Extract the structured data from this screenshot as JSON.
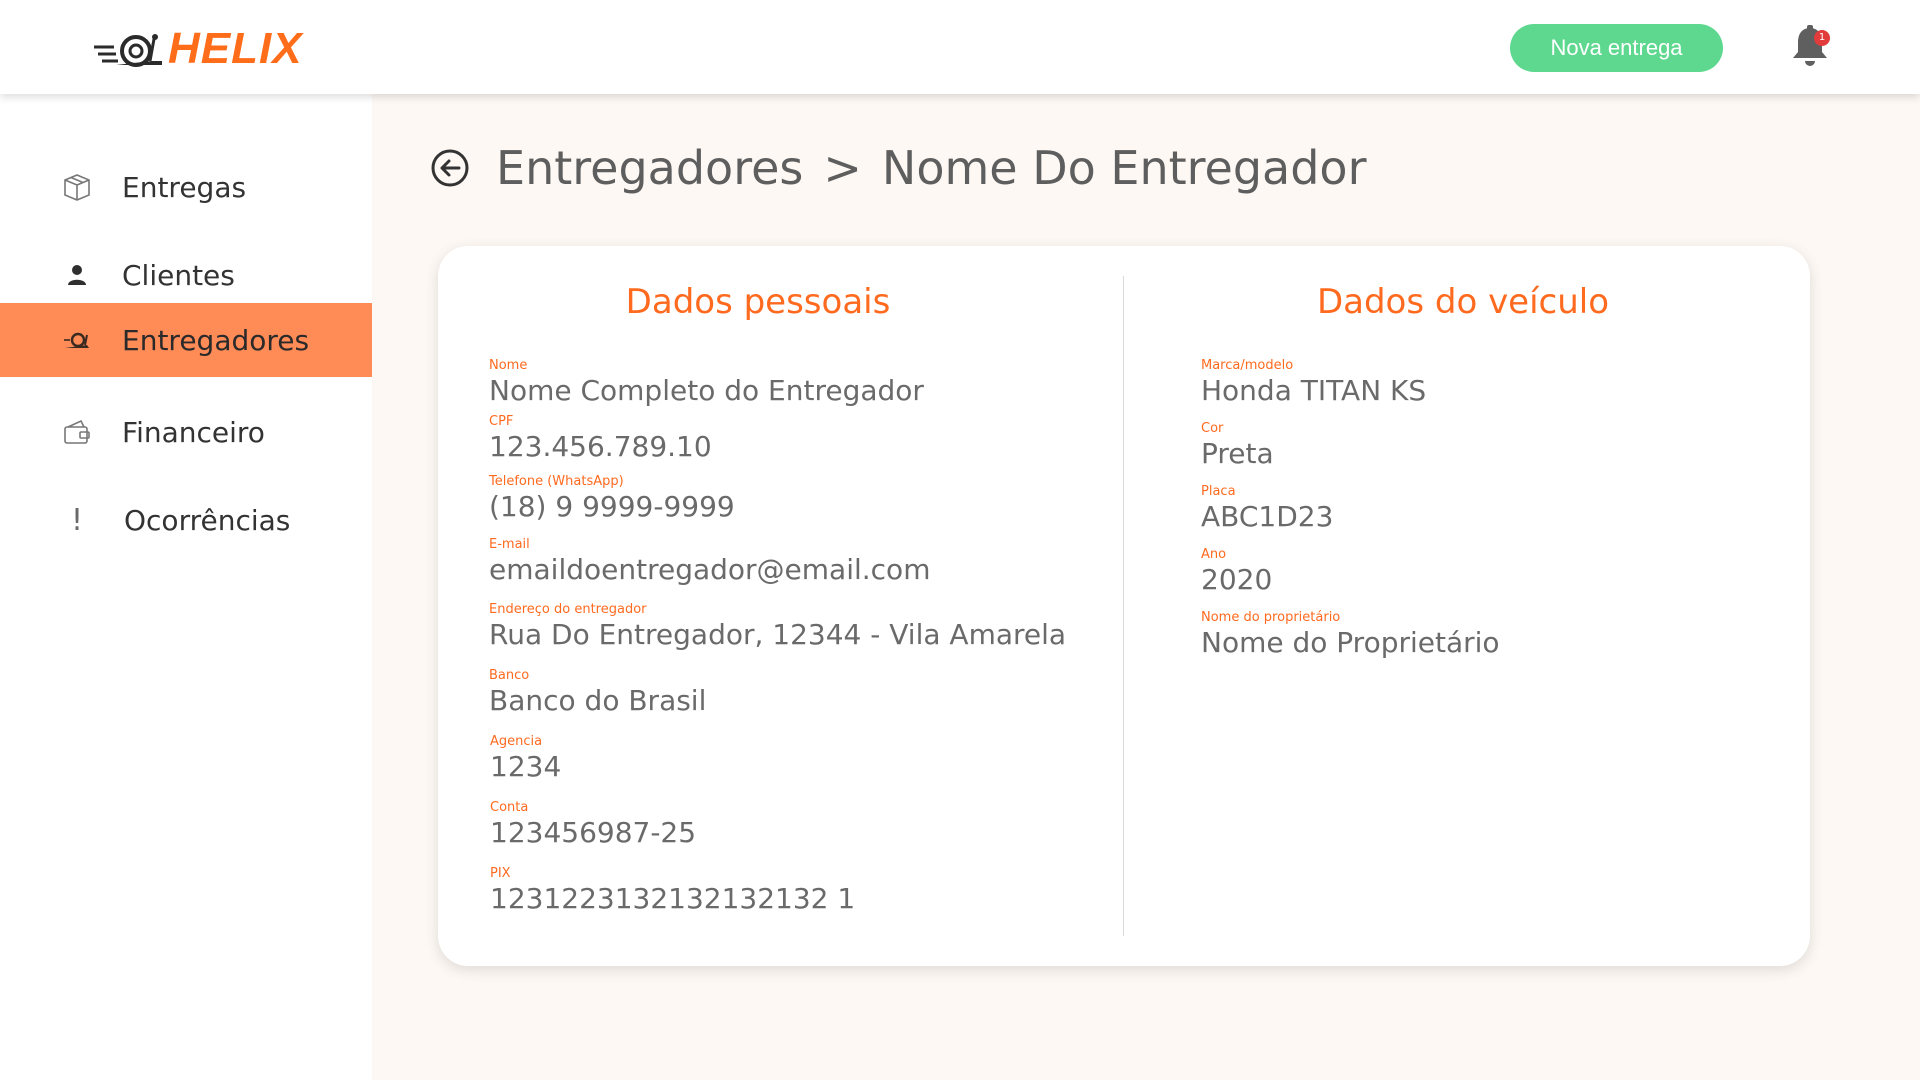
{
  "brand": {
    "name": "HELIX",
    "accent_color": "#ff6d1a"
  },
  "header": {
    "new_delivery_label": "Nova entrega",
    "notification_count": "1"
  },
  "sidebar": {
    "items": [
      {
        "label": "Entregas",
        "icon": "box-icon",
        "active": false
      },
      {
        "label": "Clientes",
        "icon": "user-icon",
        "active": false
      },
      {
        "label": "Entregadores",
        "icon": "snail-icon",
        "active": true
      },
      {
        "label": "Financeiro",
        "icon": "wallet-icon",
        "active": false
      },
      {
        "label": "Ocorrências",
        "icon": "exclamation-icon",
        "active": false
      }
    ],
    "active_color": "#ff8b57"
  },
  "breadcrumb": {
    "parent": "Entregadores",
    "separator": ">",
    "current": "Nome Do Entregador"
  },
  "personal": {
    "title": "Dados pessoais",
    "fields": [
      {
        "label": "Nome",
        "value": "Nome Completo do Entregador"
      },
      {
        "label": "CPF",
        "value": "123.456.789.10"
      },
      {
        "label": "Telefone (WhatsApp)",
        "value": "(18) 9 9999-9999"
      },
      {
        "label": "E-mail",
        "value": "emaildoentregador@email.com"
      },
      {
        "label": "Endereço do entregador",
        "value": "Rua Do Entregador, 12344 - Vila Amarela"
      },
      {
        "label": "Banco",
        "value": "Banco do Brasil"
      },
      {
        "label": "Agencia",
        "value": "1234"
      },
      {
        "label": "Conta",
        "value": "123456987-25"
      },
      {
        "label": "PIX",
        "value": "1231223132132132132 1"
      }
    ]
  },
  "vehicle": {
    "title": "Dados do veículo",
    "fields": [
      {
        "label": "Marca/modelo",
        "value": "Honda TITAN KS"
      },
      {
        "label": "Cor",
        "value": "Preta"
      },
      {
        "label": "Placa",
        "value": "ABC1D23"
      },
      {
        "label": "Ano",
        "value": "2020"
      },
      {
        "label": "Nome do proprietário",
        "value": "Nome do Proprietário"
      }
    ]
  }
}
